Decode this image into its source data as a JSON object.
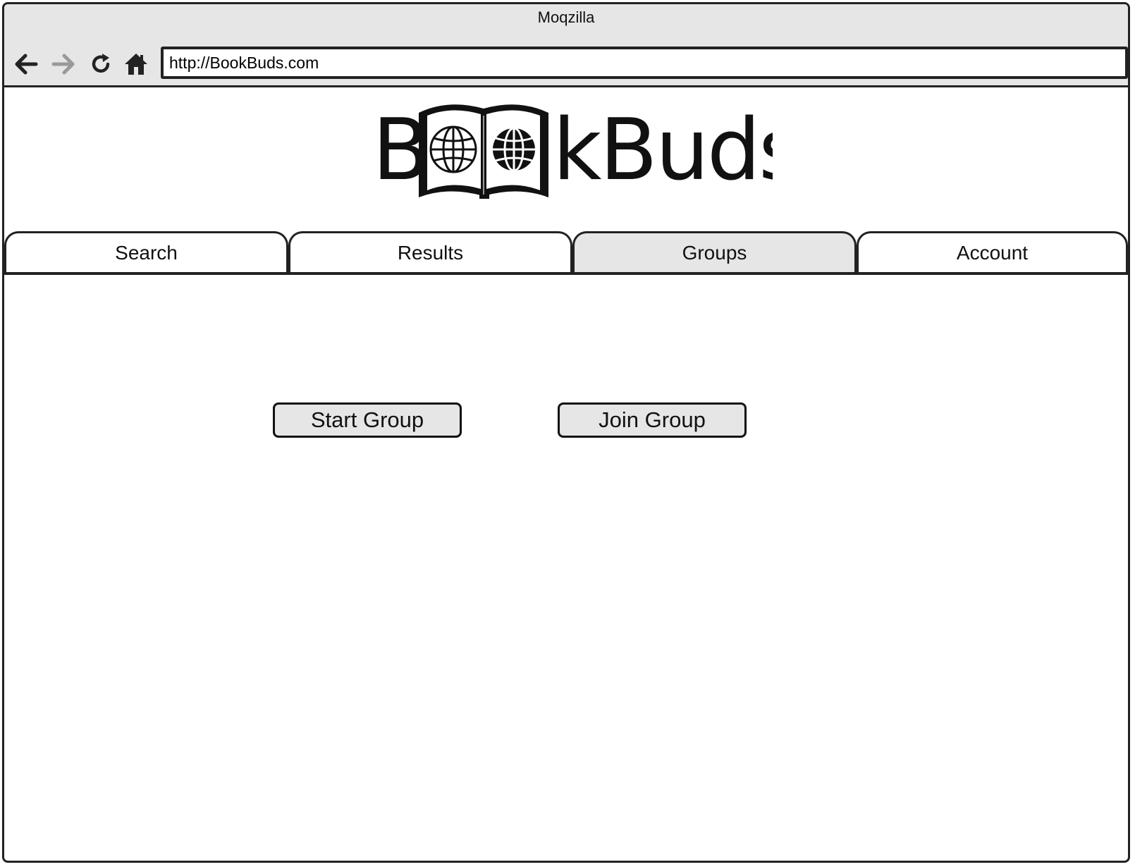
{
  "browser": {
    "title": "Moqzilla",
    "url": "http://BookBuds.com",
    "nav_icons": {
      "back": "back-arrow-icon",
      "forward": "forward-arrow-icon",
      "reload": "reload-icon",
      "home": "home-icon"
    }
  },
  "logo": {
    "text": "BookBuds"
  },
  "tabs": [
    {
      "label": "Search",
      "active": false
    },
    {
      "label": "Results",
      "active": false
    },
    {
      "label": "Groups",
      "active": true
    },
    {
      "label": "Account",
      "active": false
    }
  ],
  "actions": {
    "start_group_label": "Start Group",
    "join_group_label": "Join Group"
  },
  "colors": {
    "chrome_background": "#e6e6e6",
    "border": "#222222",
    "page_background": "#ffffff",
    "active_tab": "#e6e6e6",
    "button_background": "#e6e6e6"
  }
}
